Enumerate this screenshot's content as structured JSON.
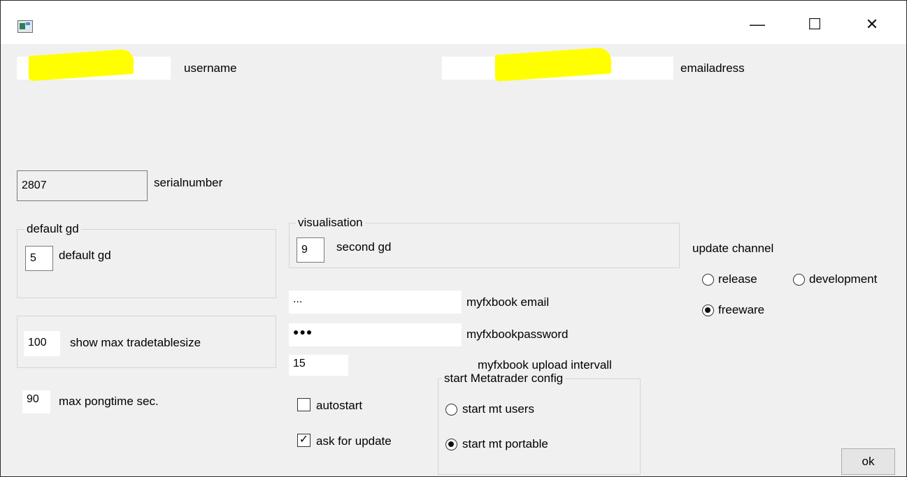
{
  "window": {
    "minimize": "—",
    "maximize": "☐",
    "close": "✕"
  },
  "fields": {
    "username_label": "username",
    "email_label": "emailadress",
    "serial_value": "2807",
    "serial_label": "serialnumber"
  },
  "default_gd_group": {
    "title": "default gd",
    "value": "5",
    "label": "default gd"
  },
  "tradetable": {
    "value": "100",
    "label": "show max tradetablesize"
  },
  "pong": {
    "value": "90",
    "label": "max pongtime sec."
  },
  "visualisation_group": {
    "title": "visualisation",
    "value": "9",
    "label": "second gd"
  },
  "myfxbook": {
    "email_value": "...",
    "email_label": "myfxbook email",
    "password_value": "●●●",
    "password_label": "myfxbookpassword",
    "interval_value": "15",
    "interval_label": "myfxbook upload intervall"
  },
  "checks": {
    "autostart": "autostart",
    "ask_update": "ask for update",
    "check_mark": "✓"
  },
  "mt_group": {
    "title": "start Metatrader config",
    "users": "start mt users",
    "portable": "start mt portable"
  },
  "update_channel": {
    "title": "update channel",
    "release": "release",
    "development": "development",
    "freeware": "freeware"
  },
  "ok": "ok",
  "colors": {
    "background": "#f0f0f0",
    "highlight": "#ffff00"
  }
}
